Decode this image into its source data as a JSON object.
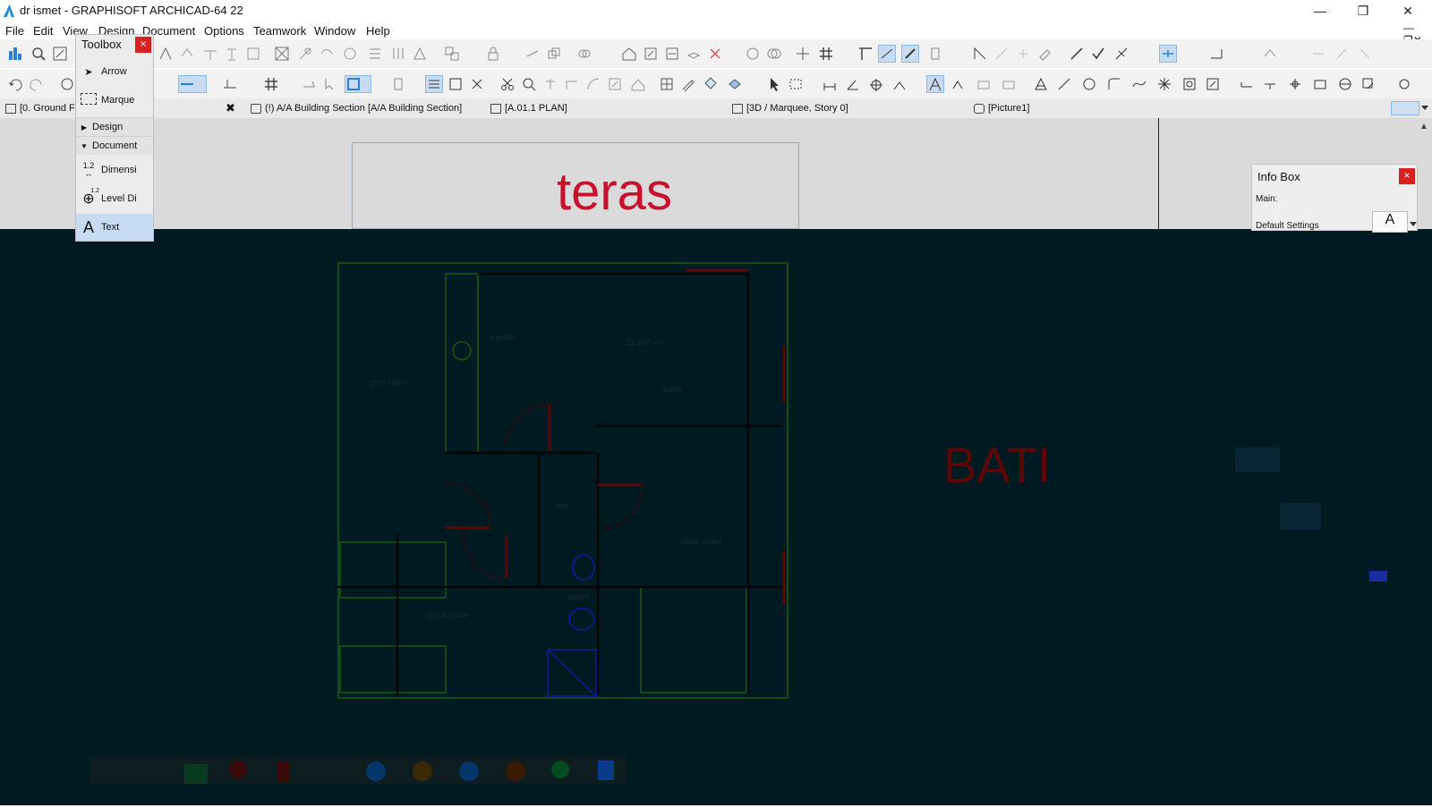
{
  "window": {
    "title": "dr ismet - GRAPHISOFT ARCHICAD-64 22"
  },
  "menu": [
    "File",
    "Edit",
    "View",
    "Design",
    "Document",
    "Options",
    "Teamwork",
    "Window",
    "Help"
  ],
  "toolbox": {
    "title": "Toolbox",
    "close": "×",
    "arrow": "Arrow",
    "marquee": "Marque",
    "design": "Design",
    "document": "Document",
    "dimension": "Dimensi",
    "level": "Level Di",
    "text": "Text",
    "dim_icon_label": "1.2",
    "level_icon_label": "1.2"
  },
  "tabs": {
    "story": "[0. Ground F",
    "tab1": "(!) A/A Building Section [A/A Building Section]",
    "tab2": "[A.01.1 PLAN]",
    "tab3": "[3D / Marquee, Story 0]",
    "tab4": "[Picture1]",
    "close": "✖"
  },
  "canvas": {
    "label_top": "teras",
    "label_right": "BATI"
  },
  "infobox": {
    "title": "Info Box",
    "close": "×",
    "main": "Main:",
    "default": "Default Settings"
  },
  "colors": {
    "accent": "#1e88e5",
    "label_red": "#c8102e",
    "dark_bg": "#001a21",
    "close_red": "#d92020"
  }
}
